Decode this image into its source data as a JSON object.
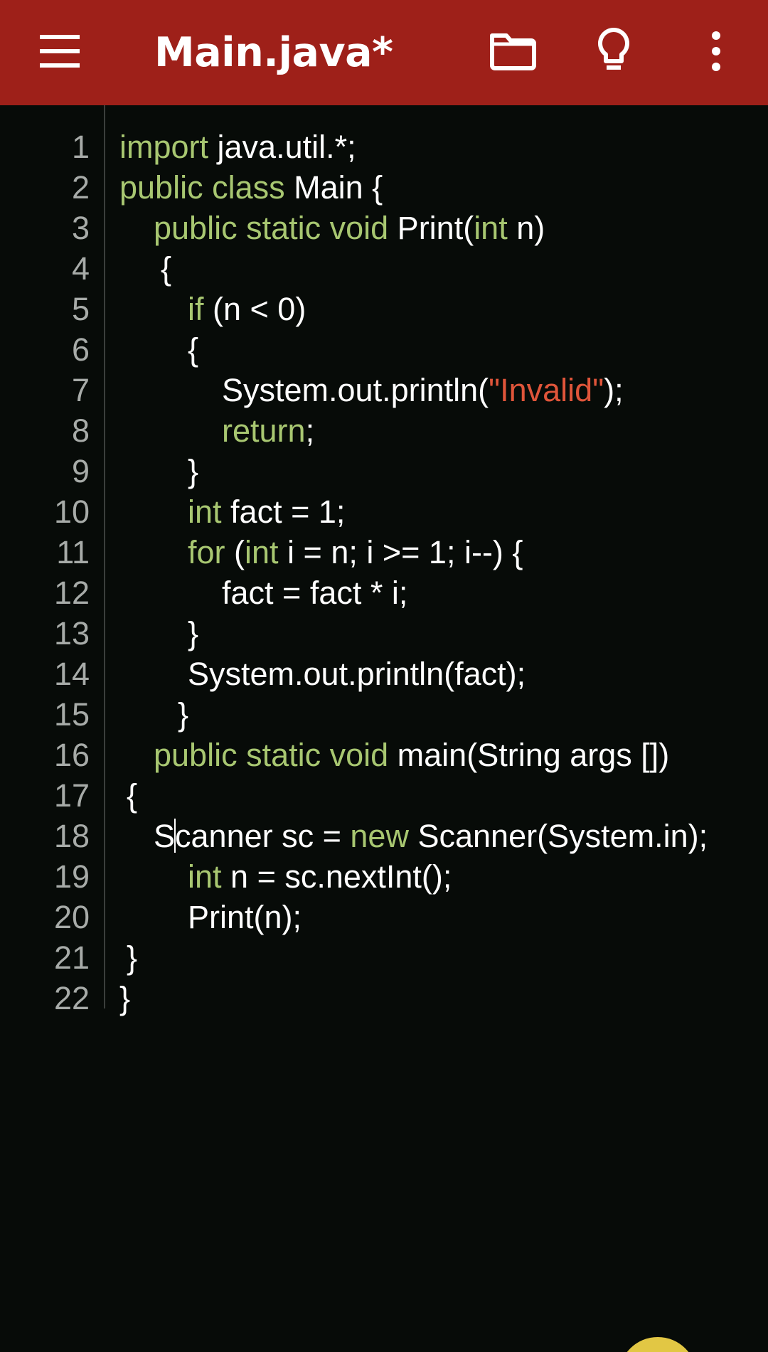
{
  "app_bar": {
    "title": "Main.java*",
    "background": "#9e2019",
    "icons": {
      "menu": "hamburger-menu-icon",
      "files": "folder-icon",
      "hint": "lightbulb-icon",
      "more": "more-vertical-icon"
    }
  },
  "editor": {
    "background": "#070b08",
    "keyword_color": "#a8c771",
    "string_color": "#e0553a",
    "lines": [
      {
        "n": "1",
        "t": [
          {
            "k": true,
            "s": "import"
          },
          {
            "s": " java.util.*;"
          }
        ]
      },
      {
        "n": "2",
        "t": [
          {
            "k": true,
            "s": "public class"
          },
          {
            "s": " Main {"
          }
        ]
      },
      {
        "n": "3",
        "t": [
          {
            "k": true,
            "s": "public static void"
          },
          {
            "s": " Print("
          },
          {
            "k": true,
            "s": "int"
          },
          {
            "s": " n)"
          }
        ]
      },
      {
        "n": "4",
        "t": [
          {
            "s": "{"
          }
        ]
      },
      {
        "n": "5",
        "t": [
          {
            "k": true,
            "s": "if"
          },
          {
            "s": " (n < 0)"
          }
        ]
      },
      {
        "n": "6",
        "t": [
          {
            "s": "{"
          }
        ]
      },
      {
        "n": "7",
        "t": [
          {
            "s": "System.out.println("
          },
          {
            "q": true,
            "s": "\"Invalid\""
          },
          {
            "s": ");"
          }
        ]
      },
      {
        "n": "8",
        "t": [
          {
            "k": true,
            "s": "return"
          },
          {
            "s": ";"
          }
        ]
      },
      {
        "n": "9",
        "t": [
          {
            "s": "}"
          }
        ]
      },
      {
        "n": "10",
        "t": [
          {
            "k": true,
            "s": "int"
          },
          {
            "s": " fact = 1;"
          }
        ]
      },
      {
        "n": "11",
        "t": [
          {
            "k": true,
            "s": "for"
          },
          {
            "s": " ("
          },
          {
            "k": true,
            "s": "int"
          },
          {
            "s": " i = n; i >= 1; i--) {"
          }
        ]
      },
      {
        "n": "12",
        "t": [
          {
            "s": "fact = fact * i;"
          }
        ]
      },
      {
        "n": "13",
        "t": [
          {
            "s": "}"
          }
        ]
      },
      {
        "n": "14",
        "t": [
          {
            "s": "System.out.println(fact);"
          }
        ]
      },
      {
        "n": "15",
        "t": [
          {
            "s": "}"
          }
        ]
      },
      {
        "n": "16",
        "t": [
          {
            "k": true,
            "s": "public static void"
          },
          {
            "s": " main(String args [])"
          }
        ]
      },
      {
        "n": "17",
        "t": [
          {
            "s": "{"
          }
        ]
      },
      {
        "n": "18",
        "t": [
          {
            "s": "S"
          },
          {
            "c": true
          },
          {
            "s": "canner sc = "
          },
          {
            "k": true,
            "s": "new"
          },
          {
            "s": " Scanner(System.in);"
          }
        ]
      },
      {
        "n": "19",
        "t": [
          {
            "k": true,
            "s": "int"
          },
          {
            "s": " n = sc.nextInt();"
          }
        ]
      },
      {
        "n": "20",
        "t": [
          {
            "s": "Print(n);"
          }
        ]
      },
      {
        "n": "21",
        "t": [
          {
            "s": "}"
          }
        ]
      },
      {
        "n": "22",
        "t": [
          {
            "s": "}"
          }
        ]
      }
    ]
  }
}
